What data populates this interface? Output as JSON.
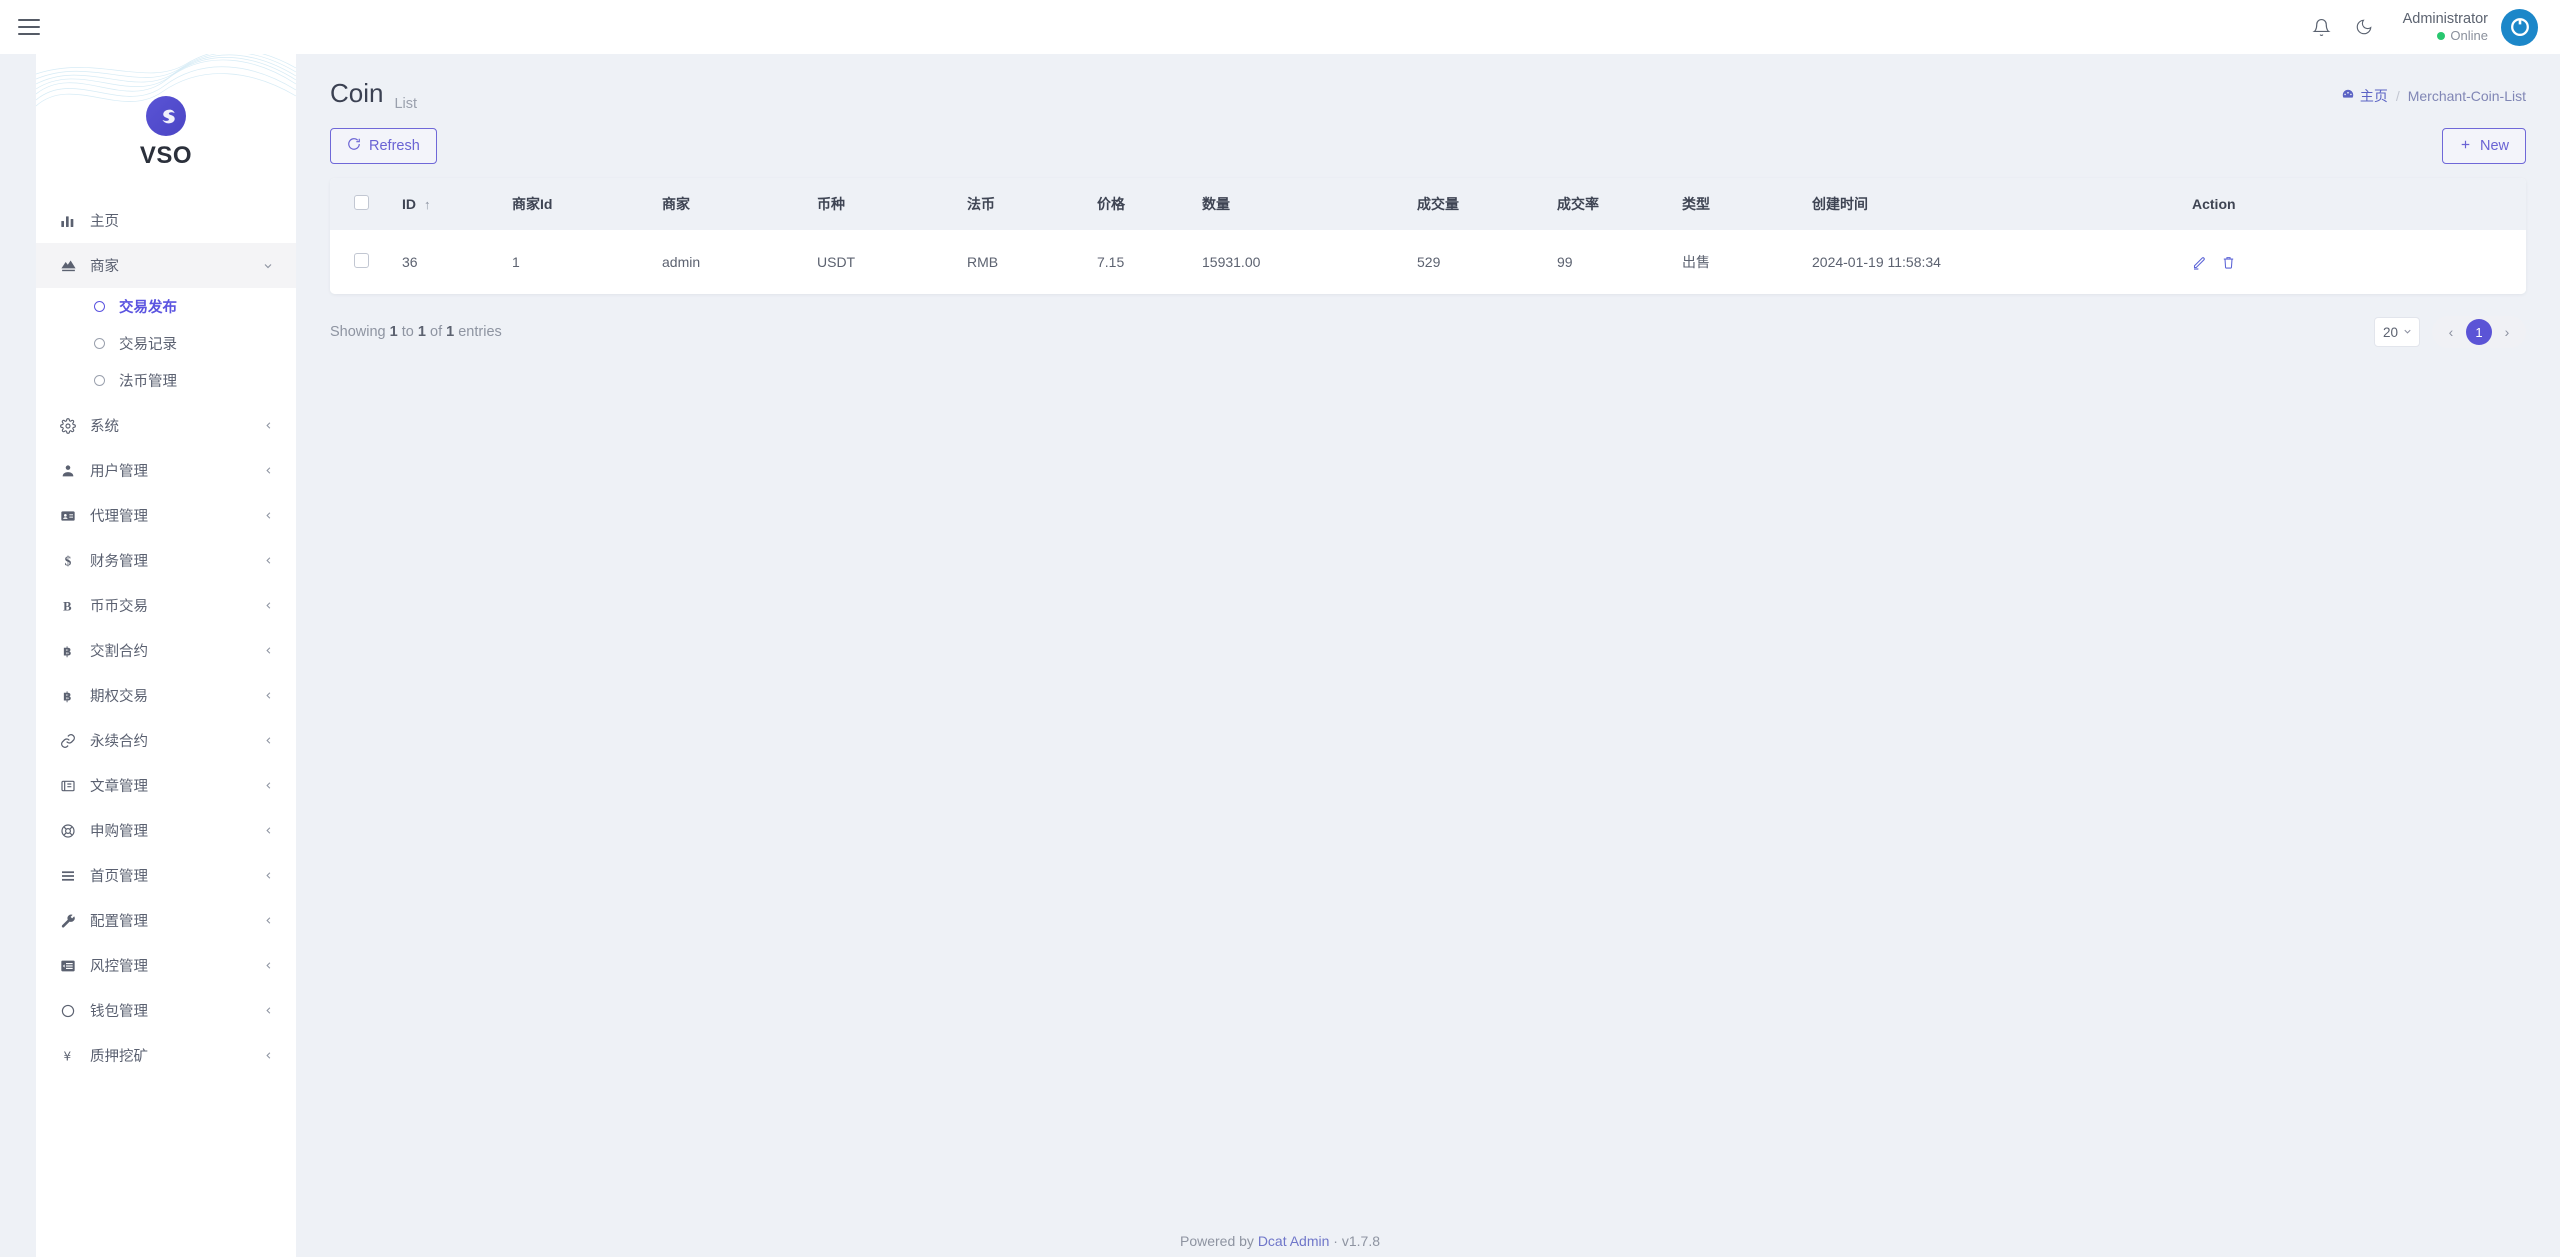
{
  "topbar": {
    "menu_toggle": "hamburger-menu",
    "notification_icon": "bell-icon",
    "theme_icon": "moon-icon",
    "user_name": "Administrator",
    "user_status": "Online"
  },
  "sidebar": {
    "brand_name": "VSO",
    "items": [
      {
        "label": "主页",
        "icon": "chart-bars-icon",
        "caret": "",
        "active": false
      },
      {
        "label": "商家",
        "icon": "merchant-icon",
        "caret": "⌄",
        "active": true
      },
      {
        "label": "系统",
        "icon": "gear-icon",
        "caret": "‹",
        "active": false
      },
      {
        "label": "用户管理",
        "icon": "user-icon",
        "caret": "‹",
        "active": false
      },
      {
        "label": "代理管理",
        "icon": "id-card-icon",
        "caret": "‹",
        "active": false
      },
      {
        "label": "财务管理",
        "icon": "dollar-icon",
        "caret": "‹",
        "active": false
      },
      {
        "label": "币币交易",
        "icon": "bold-b-icon",
        "caret": "‹",
        "active": false
      },
      {
        "label": "交割合约",
        "icon": "bitcoin-icon",
        "caret": "‹",
        "active": false
      },
      {
        "label": "期权交易",
        "icon": "bitcoin-icon",
        "caret": "‹",
        "active": false
      },
      {
        "label": "永续合约",
        "icon": "link-icon",
        "caret": "‹",
        "active": false
      },
      {
        "label": "文章管理",
        "icon": "newspaper-icon",
        "caret": "‹",
        "active": false
      },
      {
        "label": "申购管理",
        "icon": "lifebuoy-icon",
        "caret": "‹",
        "active": false
      },
      {
        "label": "首页管理",
        "icon": "list-lines-icon",
        "caret": "‹",
        "active": false
      },
      {
        "label": "配置管理",
        "icon": "wrench-icon",
        "caret": "‹",
        "active": false
      },
      {
        "label": "风控管理",
        "icon": "indent-icon",
        "caret": "‹",
        "active": false
      },
      {
        "label": "钱包管理",
        "icon": "circle-icon",
        "caret": "‹",
        "active": false
      },
      {
        "label": "质押挖矿",
        "icon": "yen-icon",
        "caret": "‹",
        "active": false
      }
    ],
    "submenu": [
      {
        "label": "交易发布",
        "active": true
      },
      {
        "label": "交易记录",
        "active": false
      },
      {
        "label": "法币管理",
        "active": false
      }
    ]
  },
  "page": {
    "title": "Coin",
    "subtitle": "List",
    "breadcrumb_home": "主页",
    "breadcrumb_sep": "/",
    "breadcrumb_current": "Merchant-Coin-List",
    "refresh_label": "Refresh",
    "new_label": "New"
  },
  "table": {
    "columns": [
      "",
      "ID",
      "商家Id",
      "商家",
      "币种",
      "法币",
      "价格",
      "数量",
      "成交量",
      "成交率",
      "类型",
      "创建时间",
      "Action"
    ],
    "sort_indicator": "↑",
    "rows": [
      {
        "id": "36",
        "merchant_id": "1",
        "merchant": "admin",
        "coin": "USDT",
        "fiat": "RMB",
        "price": "7.15",
        "quantity": "15931.00",
        "volume": "529",
        "rate": "99",
        "type": "出售",
        "created_at": "2024-01-19 11:58:34"
      }
    ]
  },
  "footer_bar": {
    "showing_prefix": "Showing",
    "from": "1",
    "to_word": "to",
    "to": "1",
    "of_word": "of",
    "total": "1",
    "entries_word": "entries",
    "per_page": "20",
    "page_prev": "‹",
    "page_current": "1",
    "page_next": "›"
  },
  "footer": {
    "powered_prefix": "Powered by",
    "brand": "Dcat Admin",
    "dot": "·",
    "version": "v1.7.8"
  },
  "colors": {
    "accent": "#5b54d6",
    "link": "#6f76c9",
    "bg": "#eef1f6",
    "online": "#28c76f"
  }
}
